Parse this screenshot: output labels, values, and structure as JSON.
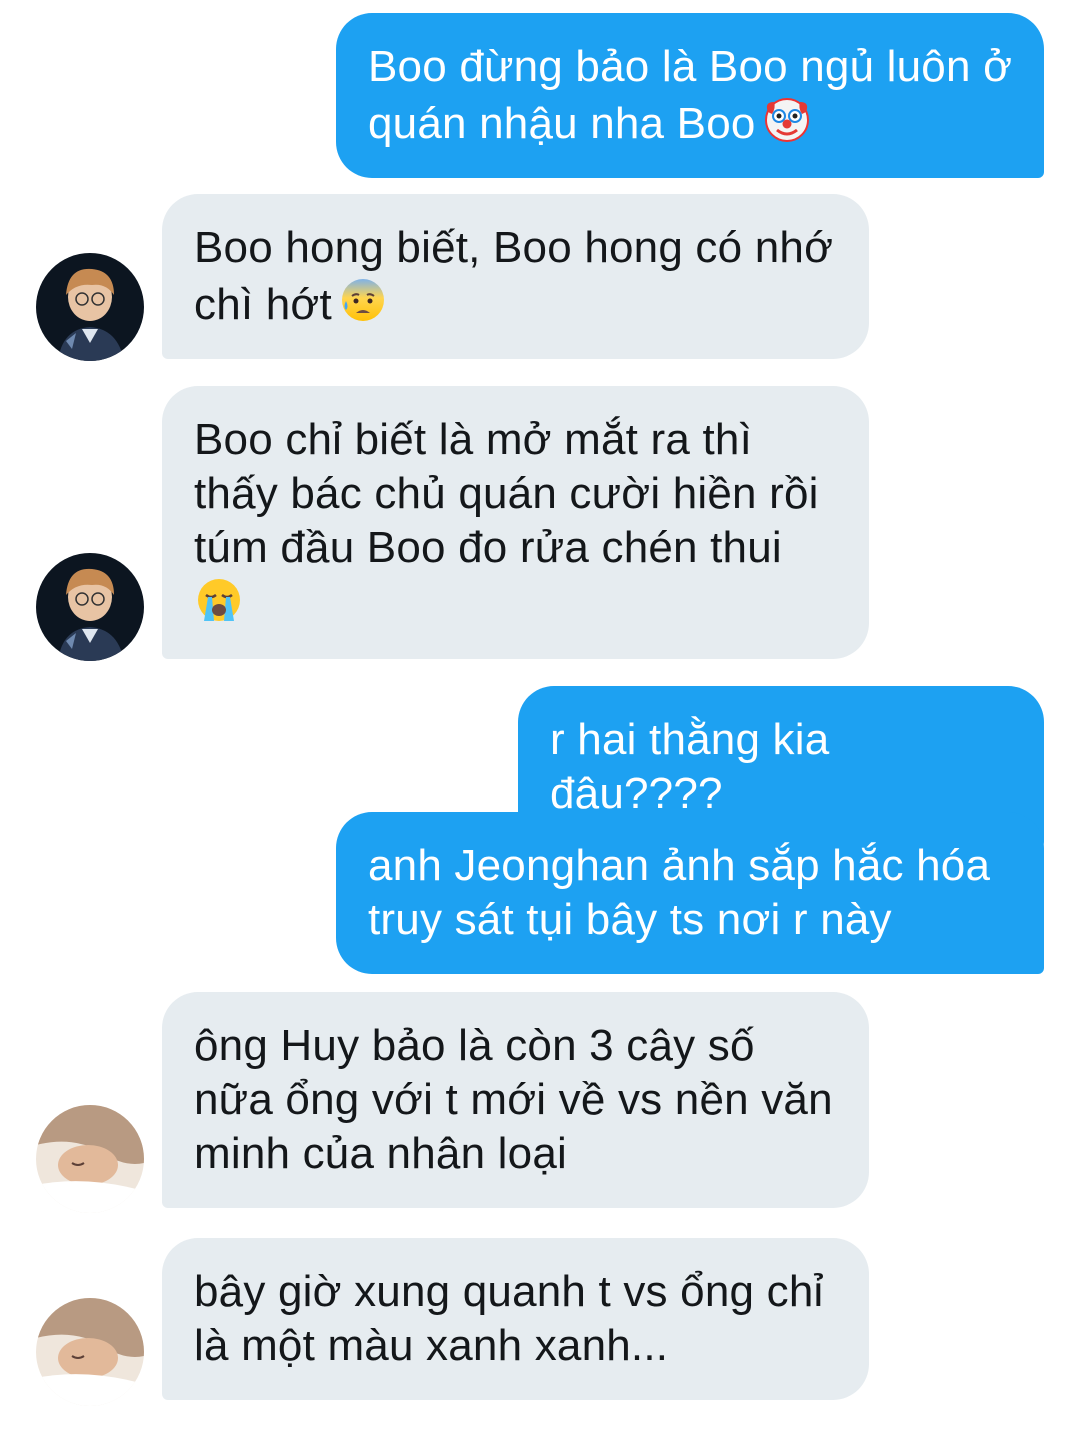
{
  "conversation": {
    "messages": [
      {
        "side": "sent",
        "text": "Boo đừng bảo là Boo ngủ luôn ở quán nhậu nha Boo",
        "emoji": "clown-face-icon"
      },
      {
        "side": "received",
        "avatar": "avatar-boy-glasses",
        "text": "Boo hong biết, Boo hong có nhớ chì hớt",
        "emoji": "anxious-sweat-face-icon"
      },
      {
        "side": "received",
        "avatar": "avatar-boy-glasses",
        "text": "Boo chỉ biết là mở mắt ra thì thấy bác chủ quán cười hiền rồi túm đầu Boo đo rửa chén thui",
        "emoji": "loudly-crying-face-icon"
      },
      {
        "side": "sent",
        "text": "r hai thằng kia đâu????"
      },
      {
        "side": "sent",
        "text": "anh Jeonghan ảnh sắp hắc hóa truy sát tụi bây ts nơi r này"
      },
      {
        "side": "received",
        "avatar": "avatar-sleeping-boy",
        "text": "ông Huy bảo là còn 3 cây số nữa ổng với t mới về vs nền văn minh của nhân loại"
      },
      {
        "side": "received",
        "avatar": "avatar-sleeping-boy",
        "text": "bây giờ xung quanh t vs ổng chỉ là một màu xanh xanh..."
      }
    ]
  },
  "colors": {
    "sent_bubble": "#1da1f2",
    "received_bubble": "#e6ecf0",
    "sent_text": "#ffffff",
    "received_text": "#14171a"
  }
}
